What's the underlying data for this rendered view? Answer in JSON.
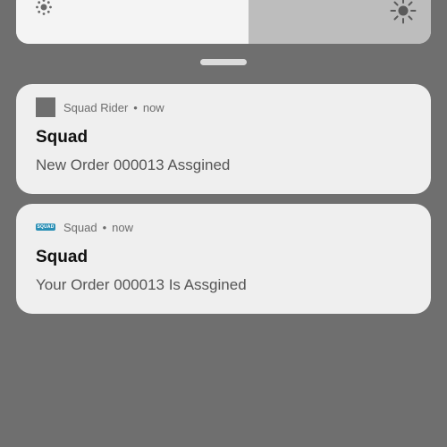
{
  "brightness": {
    "level": 0.56,
    "min_icon": "brightness-low-icon",
    "max_icon": "brightness-high-icon"
  },
  "notifications": [
    {
      "app_icon": "square-app-icon",
      "app_name": "Squad Rider",
      "separator": "•",
      "time": "now",
      "title": "Squad",
      "body": "New Order 000013 Assgined"
    },
    {
      "app_icon": "squad-logo-icon",
      "app_icon_text": "SQUAD",
      "app_name": "Squad",
      "separator": "•",
      "time": "now",
      "title": "Squad",
      "body": "Your Order 000013 Is Assgined"
    }
  ]
}
